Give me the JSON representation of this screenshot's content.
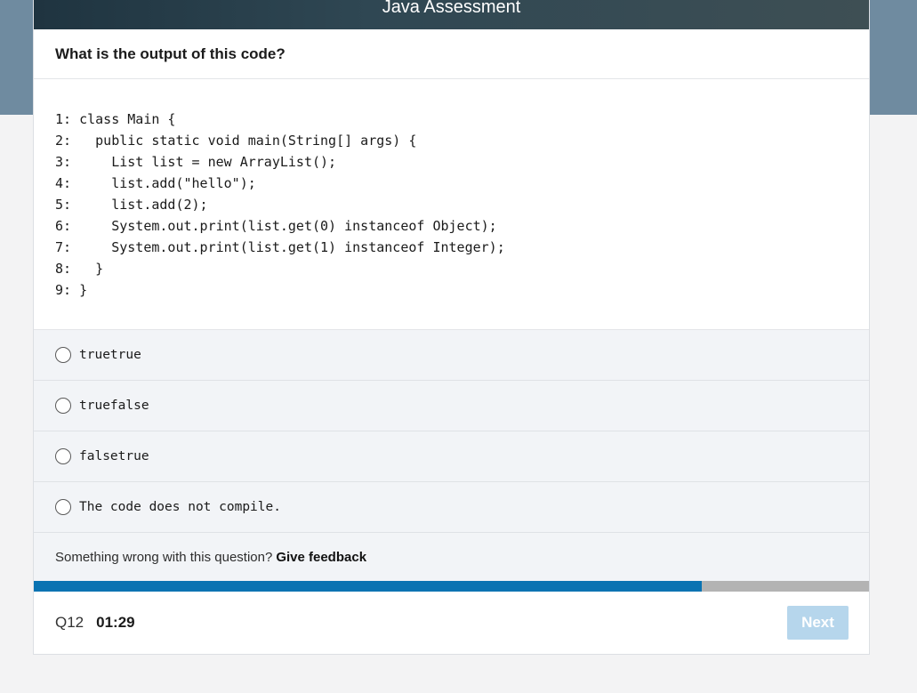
{
  "header": {
    "title": "Java Assessment"
  },
  "question": {
    "prompt": "What is the output of this code?"
  },
  "code_lines": [
    "1: class Main {",
    "2:   public static void main(String[] args) {",
    "3:     List list = new ArrayList();",
    "4:     list.add(\"hello\");",
    "5:     list.add(2);",
    "6:     System.out.print(list.get(0) instanceof Object);",
    "7:     System.out.print(list.get(1) instanceof Integer);",
    "8:   }",
    "9: }"
  ],
  "options": [
    {
      "label": "truetrue"
    },
    {
      "label": "truefalse"
    },
    {
      "label": "falsetrue"
    },
    {
      "label": "The code does not compile."
    }
  ],
  "feedback": {
    "text": "Something wrong with this question?",
    "link": "Give feedback"
  },
  "progress": {
    "fraction": 0.8
  },
  "footer": {
    "question_number": "Q12",
    "timer": "01:29",
    "next_label": "Next"
  },
  "colors": {
    "accent": "#0a73b2",
    "progress_track": "#b3b3b3",
    "next_disabled": "#b6d6ec"
  }
}
